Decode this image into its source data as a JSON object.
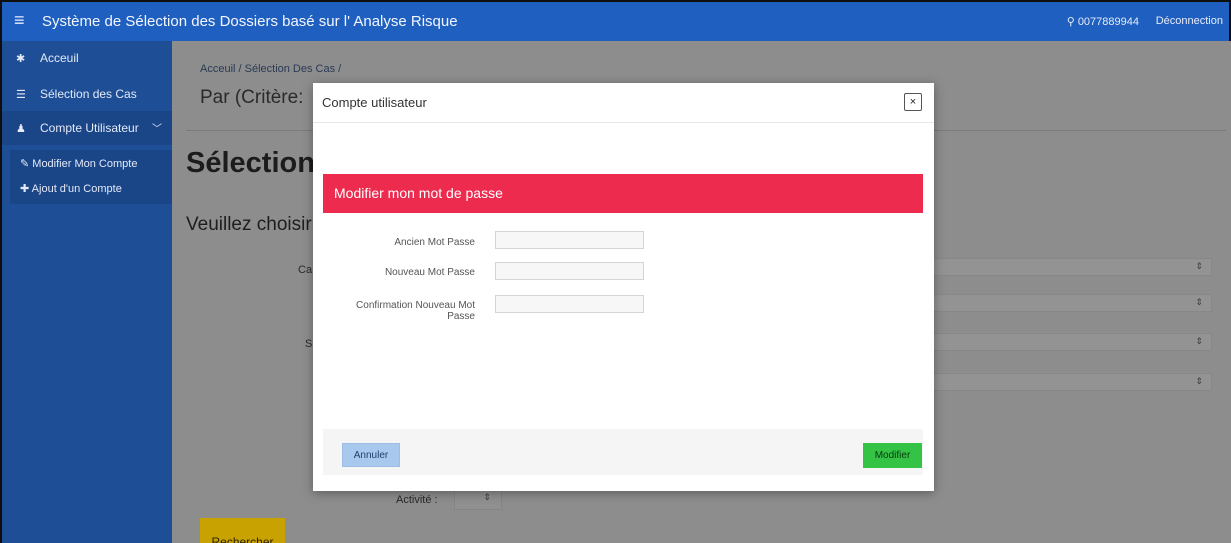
{
  "topbar": {
    "menu_icon": "hamburger-icon",
    "title": "Système de Sélection des Dossiers basé sur l' Analyse Risque",
    "user_id": "0077889944",
    "logout": "Déconnection"
  },
  "sidebar": {
    "items": [
      {
        "label": "Acceuil",
        "icon": "home-icon"
      },
      {
        "label": "Sélection des Cas",
        "icon": "list-icon"
      },
      {
        "label": "Compte Utilisateur",
        "icon": "users-icon"
      }
    ],
    "subitems": [
      {
        "label": "Modifier Mon Compte",
        "icon": "pencil-icon"
      },
      {
        "label": "Ajout d'un Compte",
        "icon": "plus-icon"
      }
    ]
  },
  "main": {
    "breadcrumb": "Acceuil / Sélection Des Cas /",
    "page_title": "Par (Critère:",
    "big_title": "Sélection",
    "subtitle": "Veuillez choisir",
    "bg_labels": [
      "Ca",
      "S",
      "Activité :"
    ],
    "search_label": "Rechercher"
  },
  "modal": {
    "title": "Compte utilisateur",
    "close_glyph": "×",
    "panel_title": "Modifier mon mot de passe",
    "fields": [
      {
        "label": "Ancien Mot Passe",
        "value": ""
      },
      {
        "label": "Nouveau Mot Passe",
        "value": ""
      },
      {
        "label_line1": "Confirmation Nouveau Mot",
        "label_line2": "Passe",
        "value": ""
      }
    ],
    "cancel_label": "Annuler",
    "modify_label": "Modifier"
  },
  "colors": {
    "topbar": "#1f5fbf",
    "sidebar": "#1d4e96",
    "panel_header": "#ec2b4e",
    "modify_button": "#35c345",
    "cancel_button": "#a9c8ee",
    "search_button": "#c8a200"
  }
}
